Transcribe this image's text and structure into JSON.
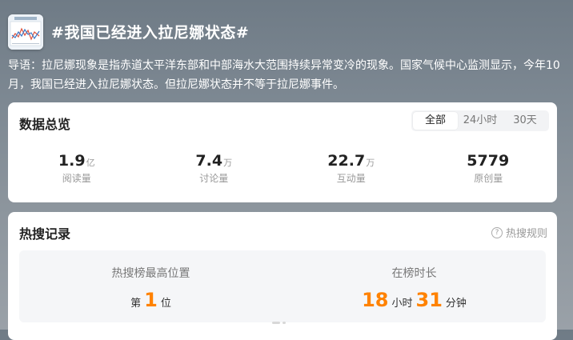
{
  "topic": {
    "title": "#我国已经进入拉尼娜状态#",
    "lead": "导语：拉尼娜现象是指赤道太平洋东部和中部海水大范围持续异常变冷的现象。国家气候中心监测显示，今年10月，我国已经进入拉尼娜状态。但拉尼娜状态并不等于拉尼娜事件。"
  },
  "overview": {
    "title": "数据总览",
    "tabs": [
      "全部",
      "24小时",
      "30天"
    ],
    "active_tab": "全部",
    "stats": [
      {
        "value": "1.9",
        "unit": "亿",
        "label": "阅读量"
      },
      {
        "value": "7.4",
        "unit": "万",
        "label": "讨论量"
      },
      {
        "value": "22.7",
        "unit": "万",
        "label": "互动量"
      },
      {
        "value": "5779",
        "unit": "",
        "label": "原创量"
      }
    ]
  },
  "hot_record": {
    "title": "热搜记录",
    "rules_link": "热搜规则",
    "peak": {
      "label": "热搜榜最高位置",
      "prefix": "第",
      "rank": "1",
      "suffix": "位"
    },
    "duration": {
      "label": "在榜时长",
      "hours": "18",
      "hours_unit": "小时",
      "minutes": "31",
      "minutes_unit": "分钟"
    }
  },
  "colors": {
    "accent": "#ff8200"
  }
}
